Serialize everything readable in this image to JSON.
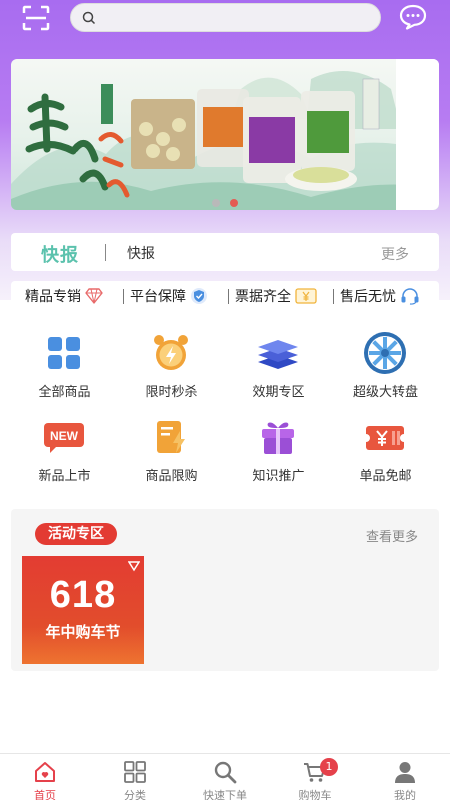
{
  "header": {
    "search_placeholder": "",
    "icons": [
      "scan-icon",
      "search-icon",
      "message-icon"
    ]
  },
  "banner": {
    "slides_total": 2,
    "active_slide": 2,
    "brand_colors": [
      "#e6f1ea",
      "#3c8d5a",
      "#e45a2f"
    ]
  },
  "news": {
    "logo": "快报",
    "text": "快报",
    "more": "更多"
  },
  "guarantees": [
    {
      "label": "精品专销",
      "icon": "diamond-icon"
    },
    {
      "label": "平台保障",
      "icon": "shield-check-icon"
    },
    {
      "label": "票据齐全",
      "icon": "invoice-icon"
    },
    {
      "label": "售后无忧",
      "icon": "headset-icon"
    }
  ],
  "categories": [
    {
      "label": "全部商品",
      "icon": "grid-apps-icon"
    },
    {
      "label": "限时秒杀",
      "icon": "alarm-clock-icon"
    },
    {
      "label": "效期专区",
      "icon": "layers-icon"
    },
    {
      "label": "超级大转盘",
      "icon": "wheel-icon"
    },
    {
      "label": "新品上市",
      "icon": "new-badge-icon"
    },
    {
      "label": "商品限购",
      "icon": "limit-flash-icon"
    },
    {
      "label": "知识推广",
      "icon": "gift-icon"
    },
    {
      "label": "单品免邮",
      "icon": "coupon-yen-icon"
    }
  ],
  "activity": {
    "title": "活动专区",
    "more": "查看更多",
    "promo": {
      "number": "618",
      "text": "年中购车节"
    }
  },
  "tabbar": {
    "items": [
      {
        "label": "首页",
        "icon": "home-icon"
      },
      {
        "label": "分类",
        "icon": "category-icon"
      },
      {
        "label": "快速下单",
        "icon": "search-icon"
      },
      {
        "label": "购物车",
        "icon": "cart-icon"
      },
      {
        "label": "我的",
        "icon": "user-icon"
      }
    ],
    "active_index": 0,
    "cart_badge": "1"
  },
  "colors": {
    "accent": "#e5414b",
    "header_purple": "#a86cf0",
    "news_green": "#5bc2ad",
    "icon_blue": "#4a8fe0",
    "icon_orange": "#f1a338"
  }
}
